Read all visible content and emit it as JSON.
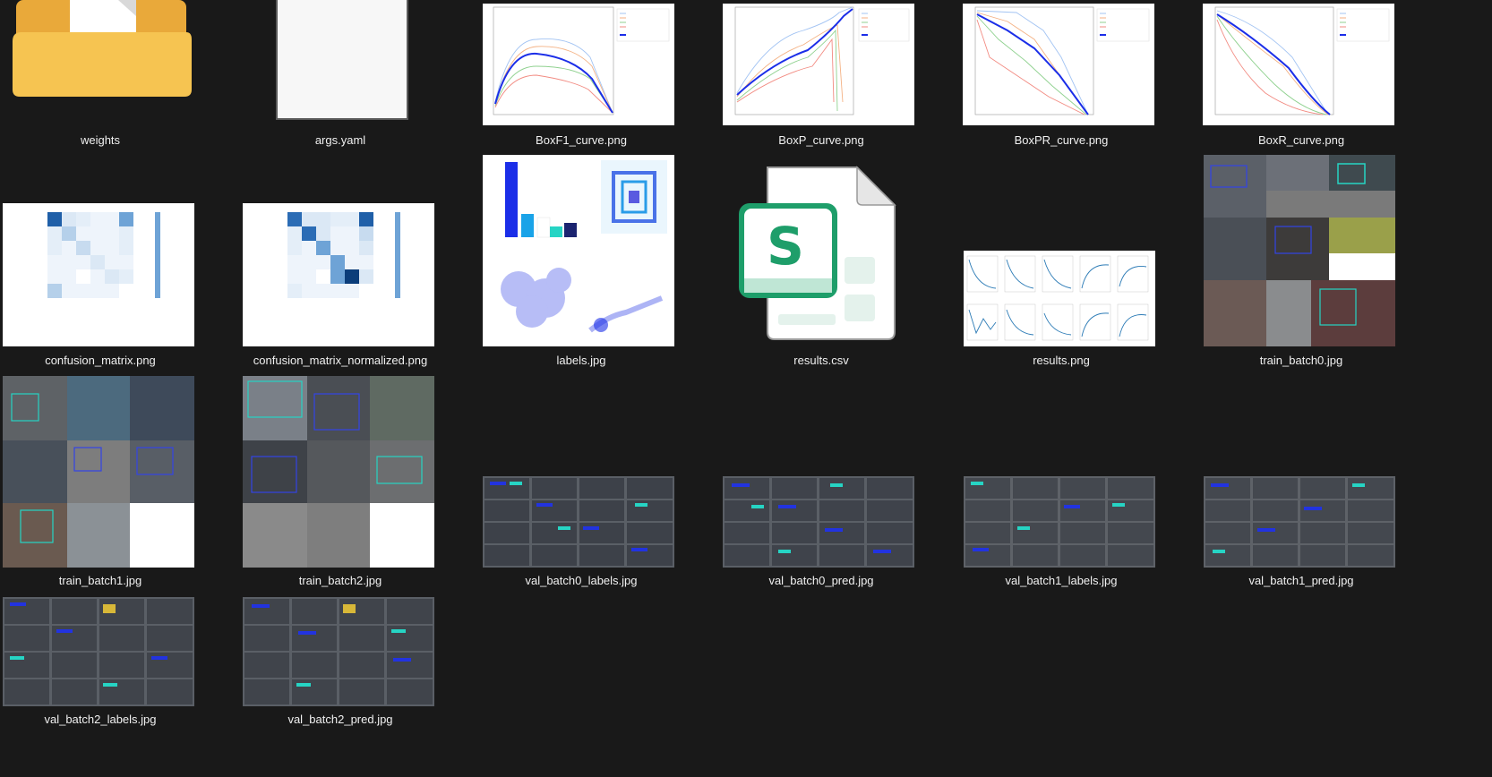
{
  "files": [
    {
      "name": "weights",
      "icon": "folder-icon"
    },
    {
      "name": "args.yaml",
      "icon": "document-icon"
    },
    {
      "name": "BoxF1_curve.png",
      "icon": "image-thumbnail"
    },
    {
      "name": "BoxP_curve.png",
      "icon": "image-thumbnail"
    },
    {
      "name": "BoxPR_curve.png",
      "icon": "image-thumbnail"
    },
    {
      "name": "BoxR_curve.png",
      "icon": "image-thumbnail"
    },
    {
      "name": "confusion_matrix.png",
      "icon": "image-thumbnail"
    },
    {
      "name": "confusion_matrix_normalized.png",
      "icon": "image-thumbnail"
    },
    {
      "name": "labels.jpg",
      "icon": "image-thumbnail"
    },
    {
      "name": "results.csv",
      "icon": "spreadsheet-icon"
    },
    {
      "name": "results.png",
      "icon": "image-thumbnail"
    },
    {
      "name": "train_batch0.jpg",
      "icon": "image-thumbnail"
    },
    {
      "name": "train_batch1.jpg",
      "icon": "image-thumbnail"
    },
    {
      "name": "train_batch2.jpg",
      "icon": "image-thumbnail"
    },
    {
      "name": "val_batch0_labels.jpg",
      "icon": "image-thumbnail"
    },
    {
      "name": "val_batch0_pred.jpg",
      "icon": "image-thumbnail"
    },
    {
      "name": "val_batch1_labels.jpg",
      "icon": "image-thumbnail"
    },
    {
      "name": "val_batch1_pred.jpg",
      "icon": "image-thumbnail"
    },
    {
      "name": "val_batch2_labels.jpg",
      "icon": "image-thumbnail"
    },
    {
      "name": "val_batch2_pred.jpg",
      "icon": "image-thumbnail"
    }
  ],
  "colors": {
    "background": "#191919",
    "folder": "#f6c451",
    "spreadsheet_green": "#1e9e6a",
    "chart_blue": "#1b2ee8"
  }
}
